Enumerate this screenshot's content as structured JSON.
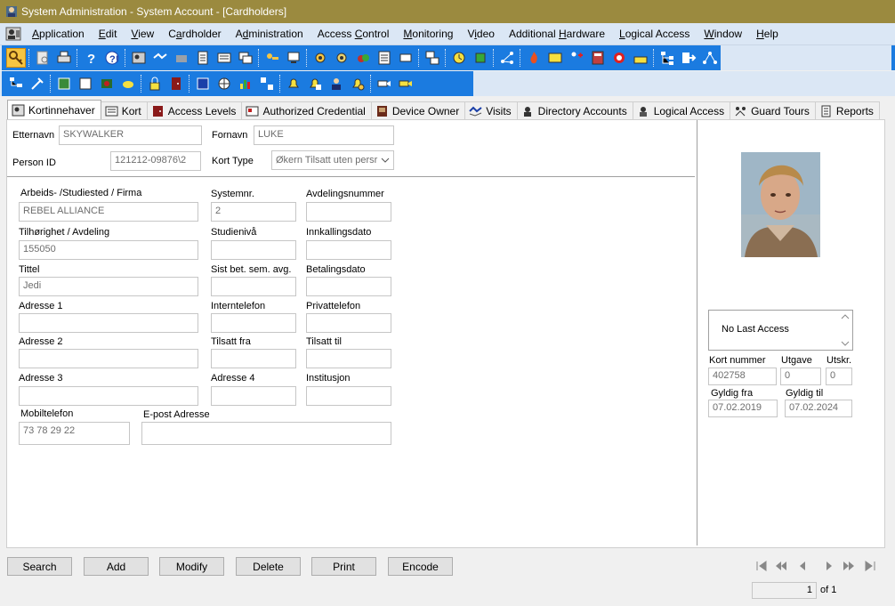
{
  "window": {
    "title": "System Administration - System Account - [Cardholders]"
  },
  "menu": [
    {
      "label": "Application",
      "ul": "A",
      "rest": "pplication"
    },
    {
      "label": "Edit",
      "ul": "E",
      "rest": "dit"
    },
    {
      "label": "View",
      "ul": "V",
      "rest": "iew"
    },
    {
      "label": "Cardholder",
      "pre": "C",
      "ul": "a",
      "rest": "rdholder"
    },
    {
      "label": "Administration",
      "pre": "A",
      "ul": "d",
      "rest": "ministration"
    },
    {
      "label": "Access Control",
      "pre": "Access ",
      "ul": "C",
      "rest": "ontrol"
    },
    {
      "label": "Monitoring",
      "ul": "M",
      "rest": "onitoring"
    },
    {
      "label": "Video",
      "pre": "V",
      "ul": "i",
      "rest": "deo"
    },
    {
      "label": "Additional Hardware",
      "pre": "Additional ",
      "ul": "H",
      "rest": "ardware"
    },
    {
      "label": "Logical Access",
      "ul": "L",
      "rest": "ogical Access"
    },
    {
      "label": "Window",
      "ul": "W",
      "rest": "indow"
    },
    {
      "label": "Help",
      "ul": "H",
      "rest": "elp"
    }
  ],
  "tabs": [
    {
      "label": "Kortinnehaver",
      "icon": "cardholder-icon",
      "selected": true
    },
    {
      "label": "Kort",
      "icon": "card-icon"
    },
    {
      "label": "Access Levels",
      "icon": "access-levels-icon"
    },
    {
      "label": "Authorized Credential",
      "icon": "credential-icon"
    },
    {
      "label": "Device Owner",
      "icon": "device-owner-icon"
    },
    {
      "label": "Visits",
      "icon": "visits-icon"
    },
    {
      "label": "Directory Accounts",
      "icon": "directory-accounts-icon"
    },
    {
      "label": "Logical Access",
      "icon": "logical-access-icon"
    },
    {
      "label": "Guard Tours",
      "icon": "guard-tours-icon"
    },
    {
      "label": "Reports",
      "icon": "reports-icon"
    }
  ],
  "form": {
    "etternavn": {
      "label": "Etternavn",
      "value": "SKYWALKER"
    },
    "fornavn": {
      "label": "Fornavn",
      "value": "LUKE"
    },
    "person_id": {
      "label": "Person ID",
      "value": "121212-09876\\2"
    },
    "kort_type": {
      "label": "Kort Type",
      "value": "Økern Tilsatt uten persr"
    },
    "arbeidssted": {
      "label": "Arbeids- /Studiested / Firma",
      "value": "REBEL ALLIANCE"
    },
    "systemnr": {
      "label": "Systemnr.",
      "value": "2"
    },
    "avdelingsnummer": {
      "label": "Avdelingsnummer",
      "value": ""
    },
    "tilhorighet": {
      "label": "Tilhørighet / Avdeling",
      "value": "155050"
    },
    "studieniva": {
      "label": "Studienivå",
      "value": ""
    },
    "innkallingsdato": {
      "label": "Innkallingsdato",
      "value": ""
    },
    "tittel": {
      "label": "Tittel",
      "value": "Jedi"
    },
    "sist_bet": {
      "label": "Sist bet. sem. avg.",
      "value": ""
    },
    "betalingsdato": {
      "label": "Betalingsdato",
      "value": ""
    },
    "adresse1": {
      "label": "Adresse 1",
      "value": ""
    },
    "interntelefon": {
      "label": "Interntelefon",
      "value": ""
    },
    "privattelefon": {
      "label": "Privattelefon",
      "value": ""
    },
    "adresse2": {
      "label": "Adresse 2",
      "value": ""
    },
    "tilsatt_fra": {
      "label": "Tilsatt fra",
      "value": ""
    },
    "tilsatt_til": {
      "label": "Tilsatt til",
      "value": ""
    },
    "adresse3": {
      "label": "Adresse 3",
      "value": ""
    },
    "adresse4": {
      "label": "Adresse 4",
      "value": ""
    },
    "institusjon": {
      "label": "Institusjon",
      "value": ""
    },
    "mobiltelefon": {
      "label": "Mobiltelefon",
      "value": "73 78 29 22"
    },
    "epost": {
      "label": "E-post Adresse",
      "value": ""
    }
  },
  "card": {
    "last_access": "No Last Access",
    "kort_nummer": {
      "label": "Kort nummer",
      "value": "402758"
    },
    "utgave": {
      "label": "Utgave",
      "value": "0"
    },
    "utskr": {
      "label": "Utskr.",
      "value": "0"
    },
    "gyldig_fra": {
      "label": "Gyldig fra",
      "value": "07.02.2019"
    },
    "gyldig_til": {
      "label": "Gyldig til",
      "value": "07.02.2024"
    }
  },
  "buttons": {
    "search": "Search",
    "add": "Add",
    "modify": "Modify",
    "delete": "Delete",
    "print": "Print",
    "encode": "Encode"
  },
  "pagination": {
    "current": "1",
    "of_label": "of 1"
  }
}
